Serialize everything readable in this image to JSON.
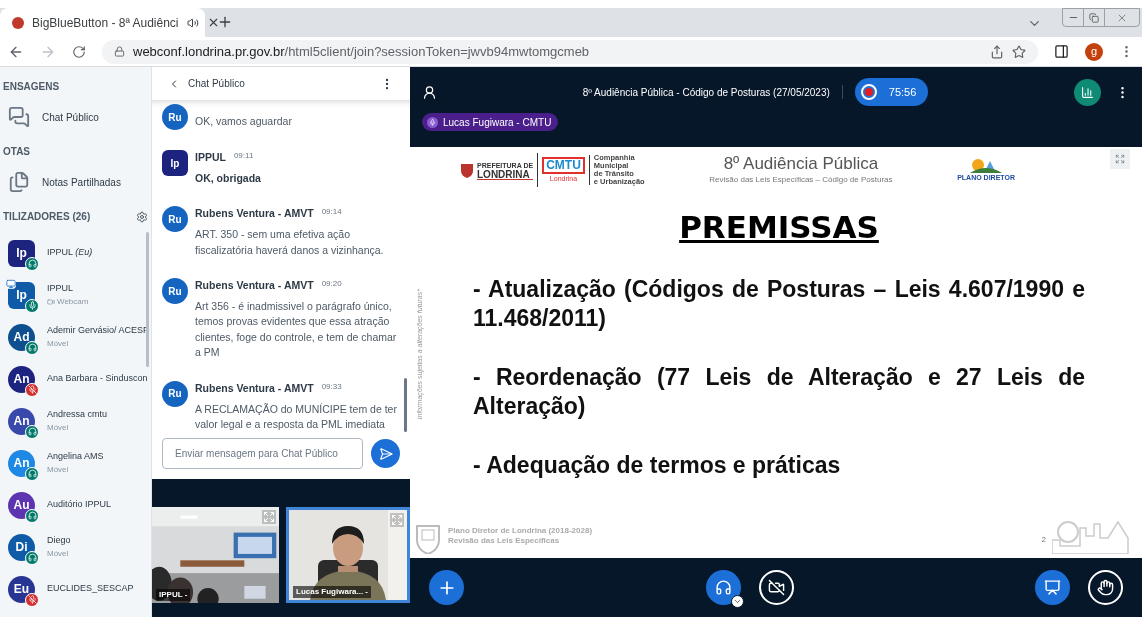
{
  "browser": {
    "tab_title": "BigBlueButton - 8ª Audiênci",
    "url_domain": "webconf.londrina.pr.gov.br",
    "url_path": "/html5client/join?sessionToken=jwvb94mwtomgcmeb",
    "profile_initial": "g"
  },
  "sidebar": {
    "messages_heading": "ENSAGENS",
    "public_chat": "Chat Público",
    "notes_heading": "OTAS",
    "shared_notes": "Notas Partilhadas",
    "users_heading": "TILIZADORES (26)",
    "users": [
      {
        "initials": "Ip",
        "color": "#1d2480",
        "moderator": true,
        "name": "IPPUL *(Eu)*",
        "muted": false,
        "listen_only": true,
        "presenter": false
      },
      {
        "initials": "Ip",
        "color": "#0f5ba8",
        "moderator": true,
        "name": "IPPUL",
        "sub": "Webcam",
        "webcam": true,
        "muted": false,
        "listen_only": false,
        "presenter": true
      },
      {
        "initials": "Ad",
        "color": "#0d4f8f",
        "moderator": false,
        "name": "Ademir Gervásio/ ACESF",
        "sub": "Móvel",
        "webcam": false,
        "muted": false,
        "listen_only": true,
        "presenter": false
      },
      {
        "initials": "An",
        "color": "#1d2480",
        "moderator": false,
        "name": "Ana Barbara - Sinduscon",
        "muted": true,
        "presenter": false
      },
      {
        "initials": "An",
        "color": "#3949ab",
        "moderator": false,
        "name": "Andressa cmtu",
        "sub": "Móvel",
        "webcam": false,
        "muted": false,
        "listen_only": true,
        "presenter": false
      },
      {
        "initials": "An",
        "color": "#1e88e5",
        "moderator": false,
        "name": "Angelina AMS",
        "sub": "Móvel",
        "webcam": false,
        "muted": false,
        "listen_only": true,
        "presenter": false
      },
      {
        "initials": "Au",
        "color": "#5e35b1",
        "moderator": false,
        "name": "Auditório IPPUL",
        "muted": false,
        "listen_only": true,
        "presenter": false
      },
      {
        "initials": "Di",
        "color": "#0f5ba8",
        "moderator": false,
        "name": "Diego",
        "sub": "Móvel",
        "webcam": false,
        "muted": false,
        "listen_only": true,
        "presenter": false
      },
      {
        "initials": "Eu",
        "color": "#283593",
        "moderator": false,
        "name": "EUCLIDES_SESCAP",
        "muted": true,
        "presenter": false
      }
    ]
  },
  "chat": {
    "title": "Chat Público",
    "messages": [
      {
        "initials": "Ru",
        "color": "#1565c0",
        "moderator": false,
        "text": "OK, vamos aguardar",
        "bold": false
      },
      {
        "initials": "Ip",
        "color": "#1d2480",
        "moderator": true,
        "author": "IPPUL",
        "time": "09:11",
        "text": "OK, obrigada",
        "bold": true
      },
      {
        "initials": "Ru",
        "color": "#1565c0",
        "moderator": false,
        "author": "Rubens Ventura - AMVT",
        "time": "09:14",
        "text": "ART. 350 - sem uma efetiva ação fiscalizatória haverá danos a vizinhança.",
        "bold": false
      },
      {
        "initials": "Ru",
        "color": "#1565c0",
        "moderator": false,
        "author": "Rubens Ventura - AMVT",
        "time": "09:20",
        "text": "Art 356 - é inadmissivel o parágrafo único, temos provas evidentes que essa atração clientes, foge do controle, e tem de chamar a PM",
        "bold": false
      },
      {
        "initials": "Ru",
        "color": "#1565c0",
        "moderator": false,
        "author": "Rubens Ventura - AMVT",
        "time": "09:33",
        "text": "A RECLAMAÇÃO do MUNÍCIPE tem de ter valor legal e a resposta da PML imediata",
        "bold": false
      }
    ],
    "input_placeholder": "Enviar mensagem para Chat Público"
  },
  "videos": [
    {
      "kind": "room",
      "label": "IPPUL -",
      "speaking": false
    },
    {
      "kind": "person",
      "label": "Lucas Fugiwara... -",
      "speaking": true
    }
  ],
  "meeting": {
    "title": "8º Audiência Pública - Código de Posturas (27/05/2023)",
    "recording": true,
    "timer": "75:56",
    "talking": "Lucas Fugiwara - CMTU"
  },
  "slide": {
    "city_top": "PREFEITURA DE",
    "city_name": "LONDRINA",
    "cmtu": "CMTU",
    "cmtu_city": "Londrina",
    "cmtu_caption": [
      "Companhia",
      "Municipal",
      "de Trânsito",
      "e Urbanização"
    ],
    "plan": "PLANO DIRETOR",
    "title": "8º Audiência Pública",
    "subtitle": "Revisão das Leis Específicas – Código de Posturas",
    "side_note": "Informações sujeitas a alterações futuras*",
    "heading": "PREMISSAS",
    "points": [
      "- Atualização (Códigos de Posturas – Leis 4.607/1990 e 11.468/2011)",
      "- Reordenação (77 Leis de Alteração e 27 Leis de Alteração)",
      "- Adequação de termos e práticas"
    ],
    "footer": [
      "Plano Diretor de Londrina (2018-2028)",
      "Revisão das Leis Específicas"
    ],
    "page": "2"
  },
  "controls": {
    "audio_joined": true,
    "camera_on": false,
    "presenting": true
  }
}
